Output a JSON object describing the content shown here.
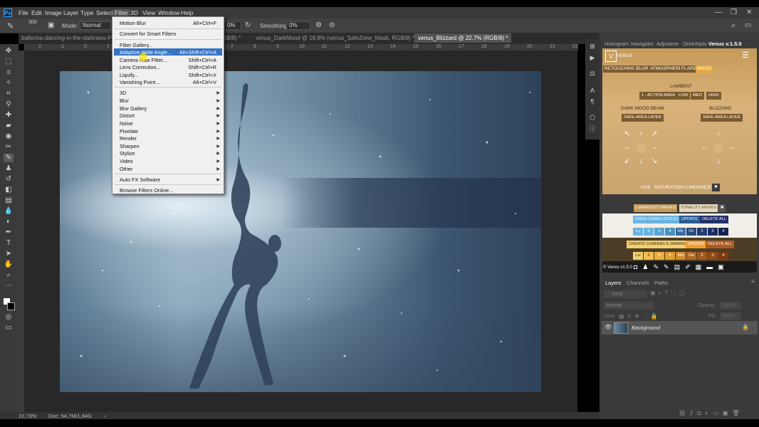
{
  "app": {
    "logo": "Ps"
  },
  "menubar": {
    "items": [
      "File",
      "Edit",
      "Image",
      "Layer",
      "Type",
      "Select",
      "Filter",
      "3D",
      "View",
      "Window",
      "Help"
    ],
    "active": "Filter"
  },
  "window_controls": {
    "minimize": "—",
    "restore": "❐",
    "close": "✕"
  },
  "options": {
    "brush_size": "300",
    "mode_label": "Mode:",
    "mode_value": "Normal",
    "opacity_value": "0%",
    "smoothing_label": "Smoothing:",
    "smoothing_value": "0%"
  },
  "tabs": [
    {
      "label": "ballerina-dancing-in-the-darkness-Pl"
    },
    {
      "label": "GB/8) *"
    },
    {
      "label": "venus_DarkMood @ 18,8% (venus_SafeZone_Mask, RGB/8) *"
    },
    {
      "label": "venus_Blizzard @ 22,7% (RGB/8) *",
      "active": true
    }
  ],
  "ruler": {
    "h": [
      "12",
      "11",
      "10",
      "9",
      "8",
      "7",
      "6",
      "5",
      "4",
      "3",
      "2",
      "1",
      "0",
      "1",
      "2",
      "3",
      "4",
      "5",
      "6",
      "7",
      "8",
      "9",
      "10",
      "11",
      "12",
      "13",
      "14",
      "15",
      "16",
      "17",
      "18",
      "19",
      "20",
      "21",
      "22",
      "23"
    ]
  },
  "filter_menu": {
    "items": [
      {
        "label": "Motion Blur",
        "shortcut": "Alt+Ctrl+F"
      },
      {
        "label": "Convert for Smart Filters",
        "shortcut": ""
      },
      {
        "label": "Filter Gallery...",
        "shortcut": ""
      },
      {
        "label": "Adaptive Wide Angle...",
        "shortcut": "Alt+Shift+Ctrl+A",
        "highlight": true
      },
      {
        "label": "Camera Raw Filter...",
        "shortcut": "Shift+Ctrl+A"
      },
      {
        "label": "Lens Correction...",
        "shortcut": "Shift+Ctrl+R"
      },
      {
        "label": "Liquify...",
        "shortcut": "Shift+Ctrl+X"
      },
      {
        "label": "Vanishing Point...",
        "shortcut": "Alt+Ctrl+V"
      },
      {
        "label": "3D",
        "submenu": true
      },
      {
        "label": "Blur",
        "submenu": true
      },
      {
        "label": "Blur Gallery",
        "submenu": true
      },
      {
        "label": "Distort",
        "submenu": true
      },
      {
        "label": "Noise",
        "submenu": true
      },
      {
        "label": "Pixelate",
        "submenu": true
      },
      {
        "label": "Render",
        "submenu": true
      },
      {
        "label": "Sharpen",
        "submenu": true
      },
      {
        "label": "Stylize",
        "submenu": true
      },
      {
        "label": "Video",
        "submenu": true
      },
      {
        "label": "Other",
        "submenu": true
      },
      {
        "label": "Auto FX Software",
        "submenu": true
      },
      {
        "label": "Browse Filters Online...",
        "shortcut": ""
      }
    ]
  },
  "status": {
    "zoom": "22,73%",
    "doc": "Doc: 54,7M/1,84G"
  },
  "panel_tabs": [
    "Histogram",
    "Navigator",
    "Adjustme",
    "OrionHplu",
    "Venus v.1.5.0"
  ],
  "venus": {
    "logo": "VENUS",
    "tabs": [
      "RETOUCHING",
      "BLUR",
      "ATMOSPHERE",
      "FLARE",
      "MOOD"
    ],
    "lambent_label": "LAMBENT",
    "lambent_buttons": [
      "1 - ACTION AREA",
      "LOW",
      "MED",
      "HIGH"
    ],
    "dark_mood_label": "DARK MOOD BEAM",
    "blizzard_label": "BLIZZARD",
    "safe_area": "SAFE-AREA LAYER",
    "hue": "HUE",
    "saturation": "SATURATION",
    "luminance": "LUMINANCE",
    "close": "✖",
    "lum_masks": "LUMINOSITY MASKS",
    "ton_masks": "TONALITY MASKS",
    "crea_canali": "CREA CANALI (COLD)",
    "update": "UPDATE",
    "delete_all": "DELETE ALL",
    "row_lc": [
      "Lc",
      "2",
      "3",
      "4",
      "Mc",
      "Oc",
      "2",
      "3",
      "4"
    ],
    "create_channels": "CREATE CHANNELS (WARM)",
    "row_lw": [
      "Lw",
      "2",
      "3",
      "4",
      "Mw",
      "Ow",
      "2",
      "3",
      "4"
    ],
    "version": "© Venus v1.5.0"
  },
  "layers": {
    "tabs": [
      "Layers",
      "Channels",
      "Paths"
    ],
    "kind": "Kind",
    "blend": "Normal",
    "opacity_label": "Opacity:",
    "opacity_value": "100%",
    "lock_label": "Lock:",
    "fill_label": "Fill:",
    "fill_value": "100%",
    "layer_name": "Background"
  }
}
